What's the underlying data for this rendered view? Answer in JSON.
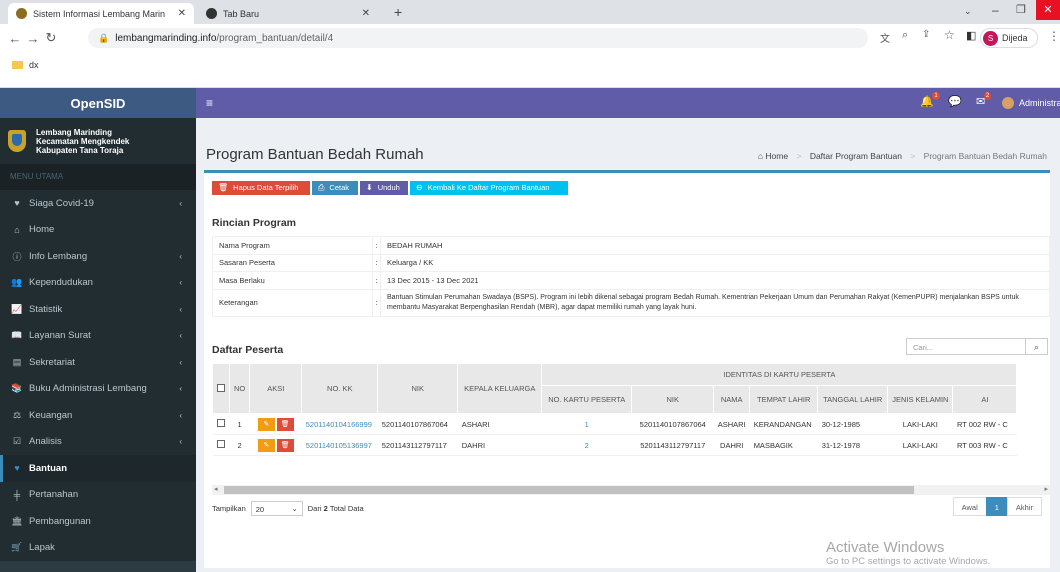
{
  "browser": {
    "tabs": [
      {
        "label": "Sistem Informasi Lembang Marin"
      },
      {
        "label": "Tab Baru"
      }
    ],
    "url_domain": "lembangmarinding.info",
    "url_path": "/program_bantuan/detail/4",
    "bookmark": "dx",
    "profile_initial": "S",
    "profile_name": "Dijeda"
  },
  "app": {
    "logo": "OpenSID",
    "village": [
      "Lembang Marinding",
      "Kecamatan Mengkendek",
      "Kabupaten Tana Toraja"
    ],
    "menu_header": "MENU UTAMA",
    "user": "Administrator",
    "notif_count_1": "1",
    "notif_count_2": "2"
  },
  "sidebar": {
    "items": [
      {
        "label": "Siaga Covid-19",
        "icon": "heart-icon"
      },
      {
        "label": "Home",
        "icon": "home-icon"
      },
      {
        "label": "Info Lembang",
        "icon": "info-icon"
      },
      {
        "label": "Kependudukan",
        "icon": "users-icon"
      },
      {
        "label": "Statistik",
        "icon": "chart-icon"
      },
      {
        "label": "Layanan Surat",
        "icon": "book-icon"
      },
      {
        "label": "Sekretariat",
        "icon": "archive-icon"
      },
      {
        "label": "Buku Administrasi Lembang",
        "icon": "books-icon"
      },
      {
        "label": "Keuangan",
        "icon": "money-icon"
      },
      {
        "label": "Analisis",
        "icon": "check-icon"
      },
      {
        "label": "Bantuan",
        "icon": "heart-icon"
      },
      {
        "label": "Pertanahan",
        "icon": "land-icon"
      },
      {
        "label": "Pembangunan",
        "icon": "building-icon"
      },
      {
        "label": "Lapak",
        "icon": "cart-icon"
      }
    ]
  },
  "page": {
    "title": "Program Bantuan Bedah Rumah",
    "breadcrumb": [
      "Home",
      "Daftar Program Bantuan",
      "Program Bantuan Bedah Rumah"
    ]
  },
  "toolbar": {
    "delete": "Hapus Data Terpilih",
    "print": "Cetak",
    "download": "Unduh",
    "back": "Kembali Ke Daftar Program Bantuan"
  },
  "rincian": {
    "title": "Rincian Program",
    "rows": [
      {
        "key": "Nama Program",
        "value": "BEDAH RUMAH"
      },
      {
        "key": "Sasaran Peserta",
        "value": "Keluarga / KK"
      },
      {
        "key": "Masa Berlaku",
        "value": "13 Dec 2015 - 13 Dec 2021"
      },
      {
        "key": "Keterangan",
        "value": "Bantuan Stimulan Perumahan Swadaya (BSPS). Program ini lebih dikenal sebagai program Bedah Rumah. Kementrian Pekerjaan Umum dan Perumahan Rakyat (KemenPUPR) menjalankan BSPS untuk membantu Masyarakat Berpenghasilan Rendah (MBR), agar dapat memiliki rumah yang layak huni."
      }
    ],
    "colon": ":"
  },
  "peserta": {
    "title": "Daftar Peserta",
    "search_placeholder": "Cari...",
    "headers": {
      "no": "NO",
      "aksi": "AKSI",
      "no_kk": "NO. KK",
      "nik": "NIK",
      "kepala": "KEPALA KELUARGA",
      "identitas": "IDENTITAS DI KARTU PESERTA",
      "no_kartu": "NO. KARTU PESERTA",
      "nik2": "NIK",
      "nama": "NAMA",
      "tempat": "TEMPAT LAHIR",
      "tanggal": "TANGGAL LAHIR",
      "jk": "JENIS KELAMIN",
      "alamat": "AI"
    },
    "rows": [
      {
        "no": "1",
        "no_kk": "5201140104166999",
        "nik": "5201140107867064",
        "kepala": "ASHARI",
        "no_kartu": "1",
        "nik2": "5201140107867064",
        "nama": "ASHARI",
        "tempat": "KERANDANGAN",
        "tanggal": "30-12-1985",
        "jk": "LAKI-LAKI",
        "alamat": "RT 002 RW - C"
      },
      {
        "no": "2",
        "no_kk": "5201140105136997",
        "nik": "5201143112797117",
        "kepala": "DAHRI",
        "no_kartu": "2",
        "nik2": "5201143112797117",
        "nama": "DAHRI",
        "tempat": "MASBAGIK",
        "tanggal": "31-12-1978",
        "jk": "LAKI-LAKI",
        "alamat": "RT 003 RW - C"
      }
    ],
    "show_label": "Tampilkan",
    "page_size": "20",
    "total_prefix": "Dari",
    "total_count": "2",
    "total_suffix": "Total Data",
    "pager": {
      "first": "Awal",
      "current": "1",
      "last": "Akhir"
    }
  },
  "watermark": {
    "line1": "Activate Windows",
    "line2": "Go to PC settings to activate Windows."
  },
  "colors": {
    "topbar": "#605ca8",
    "sidebar": "#222d32",
    "primary": "#3c8dbc",
    "danger": "#dd4b39",
    "info": "#00c0ef",
    "warning": "#f39c12",
    "download": "#605ca8"
  }
}
